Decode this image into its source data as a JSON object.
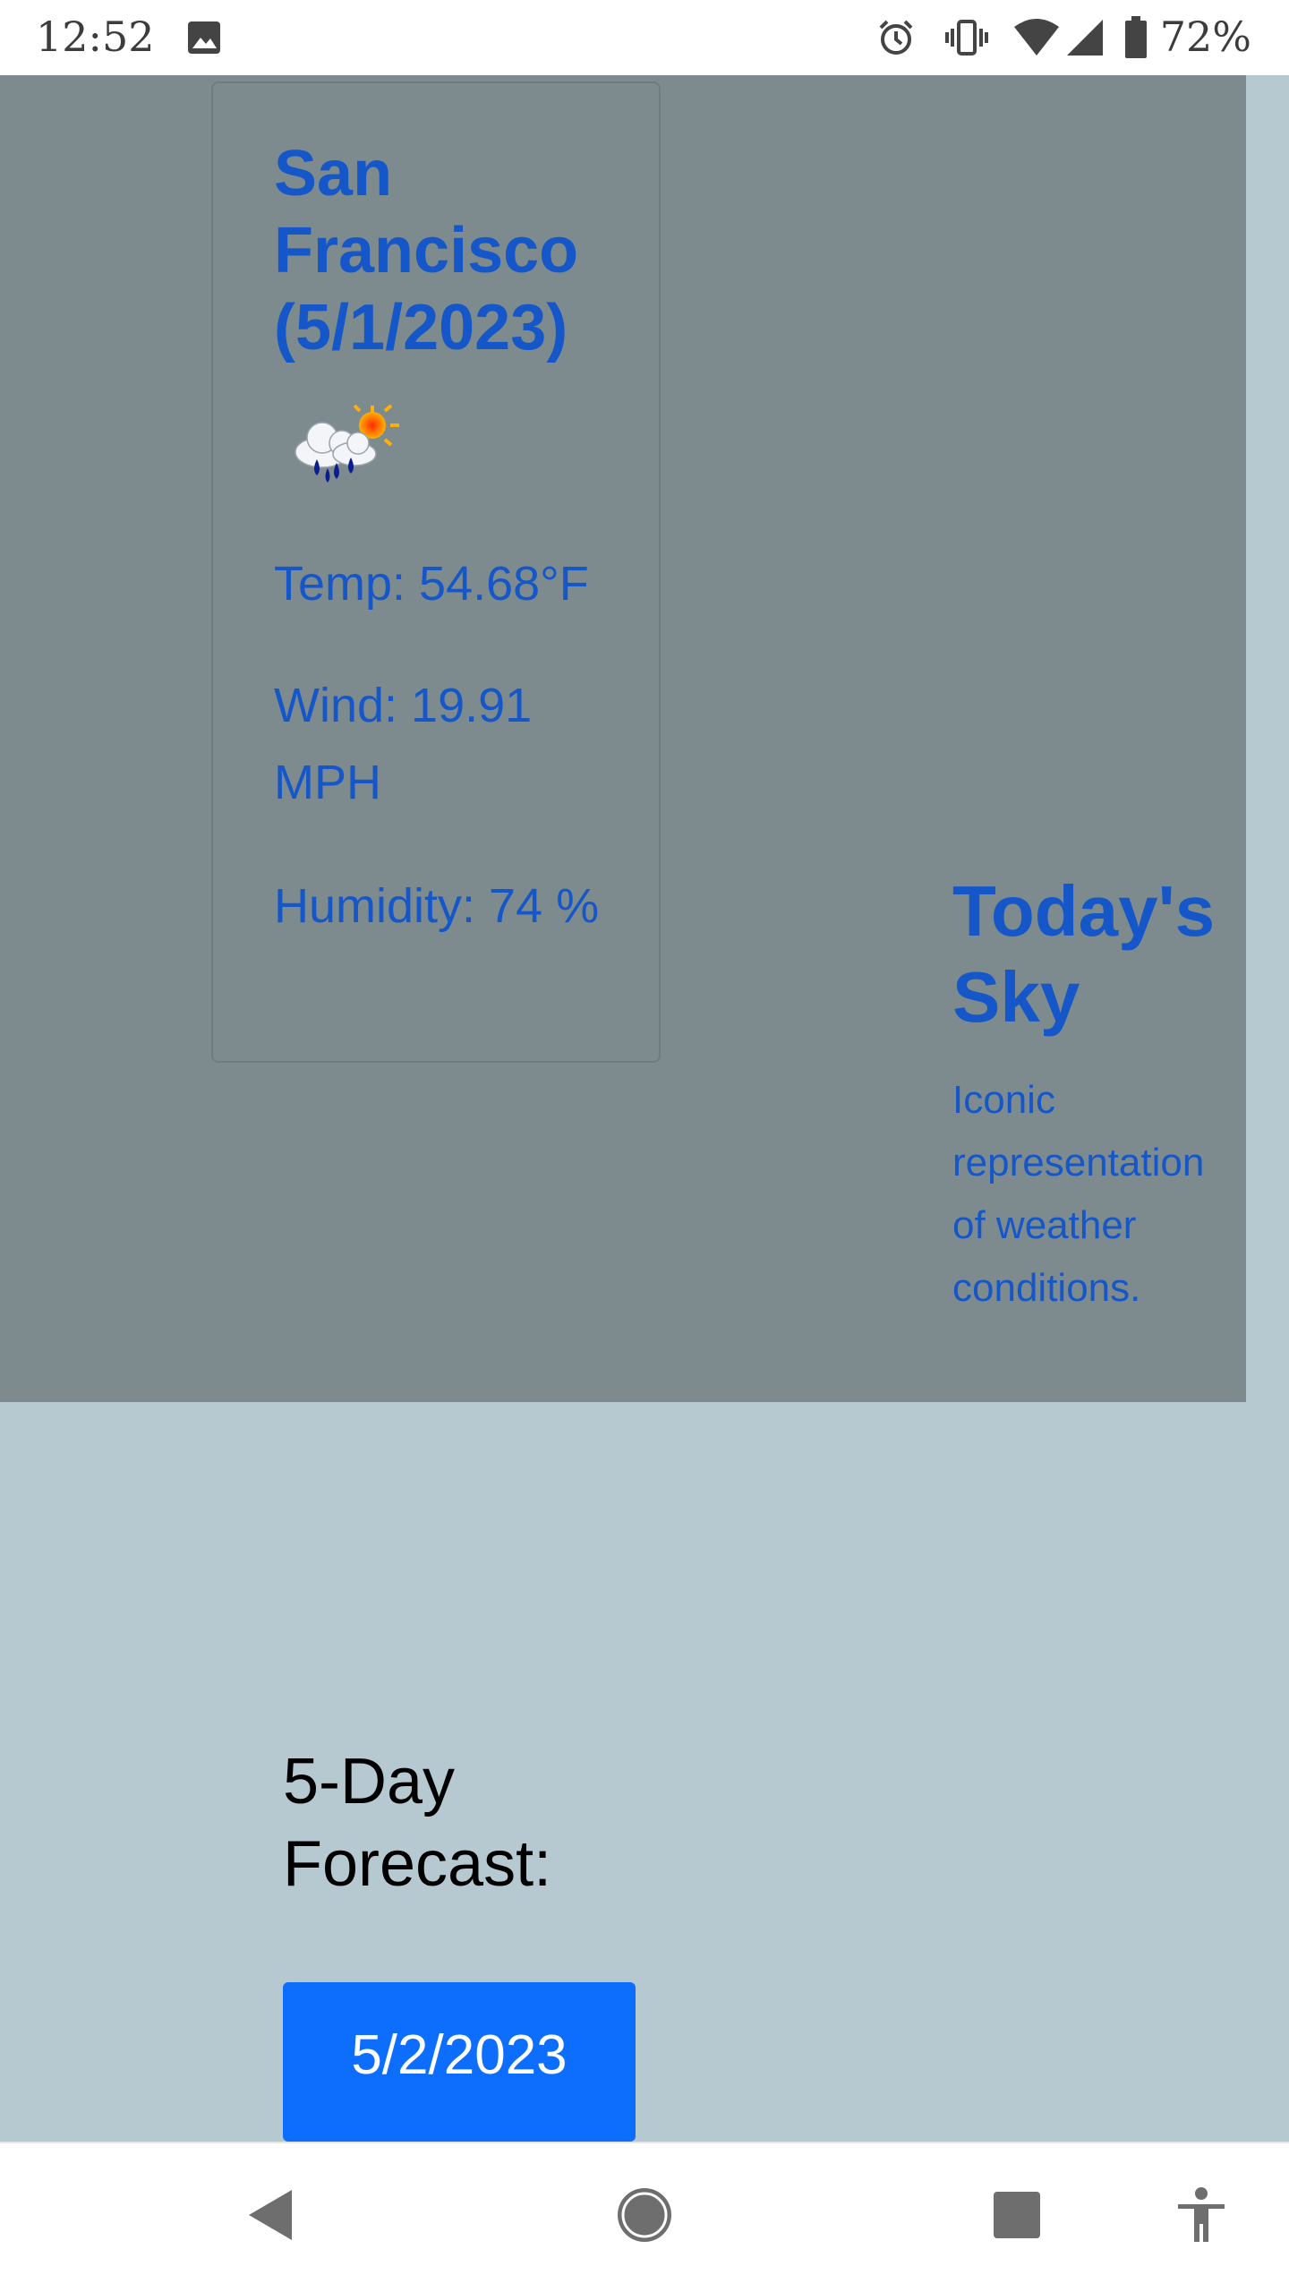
{
  "status_bar": {
    "time": "12:52",
    "battery_percent": "72%",
    "icons": [
      "image-icon",
      "alarm-icon",
      "vibrate-icon",
      "wifi-icon",
      "cell-signal-icon",
      "battery-icon"
    ]
  },
  "current": {
    "city_date": "San Francisco (5/1/2023)",
    "weather_icon": "rain-sun-cloud-icon",
    "temp": "Temp: 54.68°F",
    "wind": "Wind: 19.91 MPH",
    "humidity": "Humidity: 74 %"
  },
  "sky": {
    "title": "Today's Sky",
    "description": "Iconic representation of weather conditions."
  },
  "forecast": {
    "title": "5-Day Forecast:",
    "first_day": "5/2/2023"
  },
  "nav_bar": {
    "icons": [
      "back-icon",
      "home-icon",
      "recents-icon",
      "accessibility-icon"
    ]
  },
  "colors": {
    "hero_bg": "#7d8b8f",
    "page_bg": "#b6c9d1",
    "accent_text": "#1557c9",
    "button": "#0d6efd"
  }
}
